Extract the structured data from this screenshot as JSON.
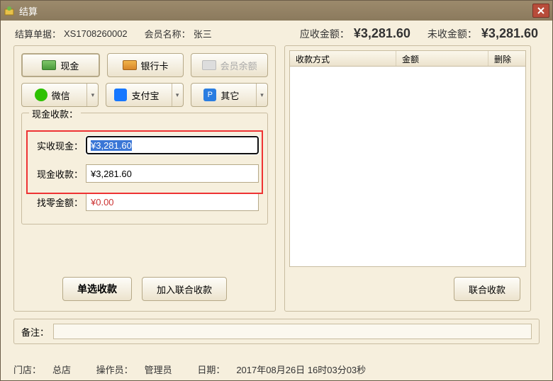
{
  "window": {
    "title": "结算"
  },
  "header": {
    "doc_no_label": "结算单据：",
    "doc_no": "XS1708260002",
    "member_label": "会员名称：",
    "member_name": "张三",
    "due_label": "应收金额：",
    "due_amount": "¥3,281.60",
    "unpaid_label": "未收金额：",
    "unpaid_amount": "¥3,281.60"
  },
  "pay_methods": {
    "cash": "现金",
    "bank": "银行卡",
    "balance": "会员余额",
    "wechat": "微信",
    "alipay": "支付宝",
    "other": "其它"
  },
  "cash_group": {
    "legend": "现金收款：",
    "actual_label": "实收现金：",
    "actual_value": "¥3,281.60",
    "received_label": "现金收款：",
    "received_value": "¥3,281.60",
    "change_label": "找零金额：",
    "change_value": "¥0.00"
  },
  "actions": {
    "single": "单选收款",
    "join": "加入联合收款",
    "union": "联合收款"
  },
  "grid": {
    "col_method": "收款方式",
    "col_amount": "金额",
    "col_delete": "删除"
  },
  "remark": {
    "label": "备注：",
    "value": ""
  },
  "footer": {
    "store_label": "门店：",
    "store": "总店",
    "operator_label": "操作员：",
    "operator": "管理员",
    "date_label": "日期：",
    "date": "2017年08月26日 16时03分03秒"
  }
}
